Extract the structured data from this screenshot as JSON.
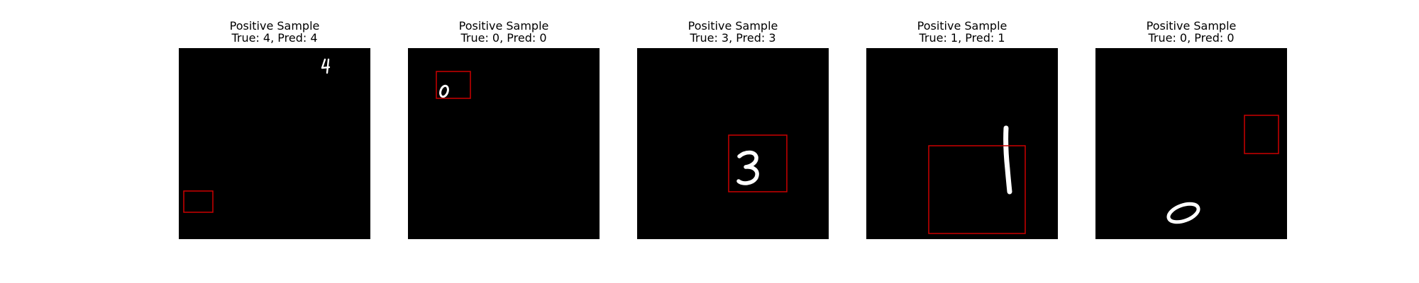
{
  "samples": [
    {
      "title": "Positive Sample",
      "subtitle": "True: 4, Pred: 4",
      "digit": "4"
    },
    {
      "title": "Positive Sample",
      "subtitle": "True: 0, Pred: 0",
      "digit": "0"
    },
    {
      "title": "Positive Sample",
      "subtitle": "True: 3, Pred: 3",
      "digit": "3"
    },
    {
      "title": "Positive Sample",
      "subtitle": "True: 1, Pred: 1",
      "digit": "1"
    },
    {
      "title": "Positive Sample",
      "subtitle": "True: 0, Pred: 0",
      "digit": "0"
    }
  ],
  "colors": {
    "box": "#cc0000",
    "digit": "#ffffff",
    "background": "#000000"
  }
}
